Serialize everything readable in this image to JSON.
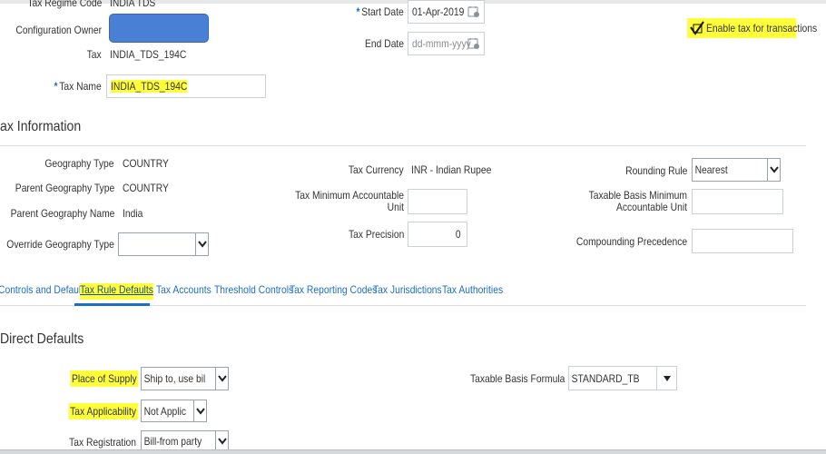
{
  "header": {
    "tax_regime_code_label": "Tax Regime Code",
    "tax_regime_code_value": "INDIA TDS",
    "configuration_owner_label": "Configuration Owner",
    "tax_label": "Tax",
    "tax_value": "INDIA_TDS_194C",
    "tax_name_label": "Tax Name",
    "tax_name_value": "INDIA_TDS_194C",
    "start_date_label": "Start Date",
    "start_date_value": "01-Apr-2019",
    "end_date_label": "End Date",
    "end_date_placeholder": "dd-mmm-yyyy",
    "enable_tax_label": "Enable tax for transactions",
    "required_mark": "*"
  },
  "tax_information": {
    "title": "ax Information",
    "geography_type_label": "Geography Type",
    "geography_type_value": "COUNTRY",
    "parent_geography_type_label": "Parent Geography Type",
    "parent_geography_type_value": "COUNTRY",
    "parent_geography_name_label": "Parent Geography Name",
    "parent_geography_name_value": "India",
    "override_geography_type_label": "Override Geography Type",
    "tax_currency_label": "Tax Currency",
    "tax_currency_value": "INR - Indian Rupee",
    "tax_min_accountable_unit_label": "Tax Minimum Accountable Unit",
    "tax_precision_label": "Tax Precision",
    "tax_precision_value": "0",
    "rounding_rule_label": "Rounding Rule",
    "rounding_rule_value": "Nearest",
    "taxable_basis_min_label": "Taxable Basis Minimum Accountable Unit",
    "compounding_precedence_label": "Compounding Precedence"
  },
  "tabs": [
    {
      "label": "Controls and Defaults"
    },
    {
      "label": "Tax Rule Defaults"
    },
    {
      "label": "Tax Accounts"
    },
    {
      "label": "Threshold Controls"
    },
    {
      "label": "Tax Reporting Codes"
    },
    {
      "label": "Tax Jurisdictions"
    },
    {
      "label": "Tax Authorities"
    }
  ],
  "direct_defaults": {
    "title": "Direct Defaults",
    "place_of_supply_label": "Place of Supply",
    "place_of_supply_value": "Ship to, use bill to if s",
    "tax_applicability_label": "Tax Applicability",
    "tax_applicability_value": "Not Applicable",
    "tax_registration_label": "Tax Registration",
    "tax_registration_value": "Bill-from party",
    "taxable_basis_formula_label": "Taxable Basis Formula",
    "taxable_basis_formula_value": "STANDARD_TB"
  },
  "colors": {
    "highlight": "#fffe3b",
    "link": "#1a6fc6",
    "redacted_box": "#4a7fd6"
  }
}
